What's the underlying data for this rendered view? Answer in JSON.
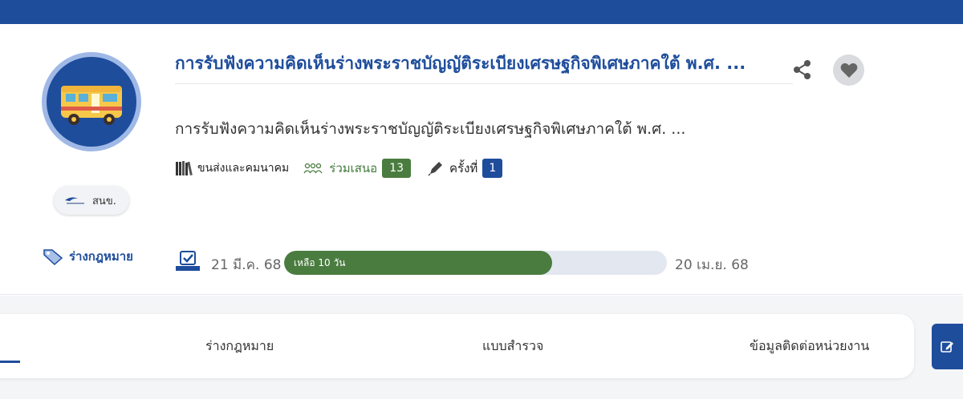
{
  "law": {
    "title": "การรับฟังความคิดเห็นร่างพระราชบัญญัติระเบียงเศรษฐกิจพิเศษภาคใต้ พ.ศ. ...",
    "description": "การรับฟังความคิดเห็นร่างพระราชบัญญัติระเบียงเศรษฐกิจพิเศษภาคใต้ พ.ศ. ...",
    "category": "ขนส่งและคมนาคม",
    "participation_label": "ร่วมเสนอ",
    "participation_count": "13",
    "times_label": "ครั้งที่",
    "times_value": "1",
    "type_label": "ร่างกฎหมาย",
    "org_name": "สนข."
  },
  "period": {
    "start_date": "21 มี.ค. 68",
    "end_date": "20 เม.ย. 68",
    "remaining_label": "เหลือ 10 วัน",
    "progress_fraction": 0.7
  },
  "tabs": [
    {
      "label": "ร่างกฎหมาย"
    },
    {
      "label": "แบบสำรวจ"
    },
    {
      "label": "ข้อมูลติดต่อหน่วยงาน"
    }
  ],
  "colors": {
    "brand": "#1e4d9c",
    "participation": "#4a7c3f",
    "favorite": "#d9dbde"
  },
  "icons": {
    "avatar": "bus-icon",
    "share": "share-icon",
    "favorite": "heart-icon",
    "category": "books-icon",
    "participation": "people-icon",
    "times": "pen-icon",
    "type": "tag-icon",
    "calendar": "calendar-check-icon",
    "edit": "edit-icon"
  }
}
